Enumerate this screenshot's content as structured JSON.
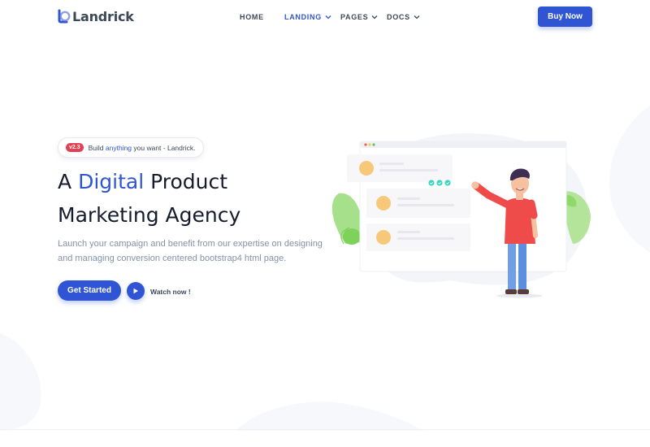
{
  "brand": {
    "name": "Landrick",
    "accent": "#2f55d4"
  },
  "nav": {
    "items": [
      {
        "label": "HOME",
        "dropdown": false,
        "active": false
      },
      {
        "label": "LANDING",
        "dropdown": true,
        "active": true
      },
      {
        "label": "PAGES",
        "dropdown": true,
        "active": false
      },
      {
        "label": "DOCS",
        "dropdown": true,
        "active": false
      }
    ],
    "cta_label": "Buy Now"
  },
  "hero": {
    "badge": {
      "version": "v2.3",
      "text_before": "Build ",
      "text_highlight": "anything",
      "text_after": " you want - Landrick."
    },
    "title_prefix": "A ",
    "title_accent": "Digital",
    "title_line1_rest": " Product",
    "title_line2": "Marketing Agency",
    "description": "Launch your campaign and benefit from our expertise on designing and managing conversion centered bootstrap4 html page.",
    "primary_button": "Get Started",
    "watch_label": "Watch now !"
  },
  "icons": {
    "logo": "landrick-logo-icon",
    "chevron": "chevron-down-icon",
    "play": "play-icon"
  },
  "colors": {
    "primary": "#2f55d4",
    "badge": "#e43f52",
    "heading": "#161c2d",
    "muted": "#8492a6"
  }
}
